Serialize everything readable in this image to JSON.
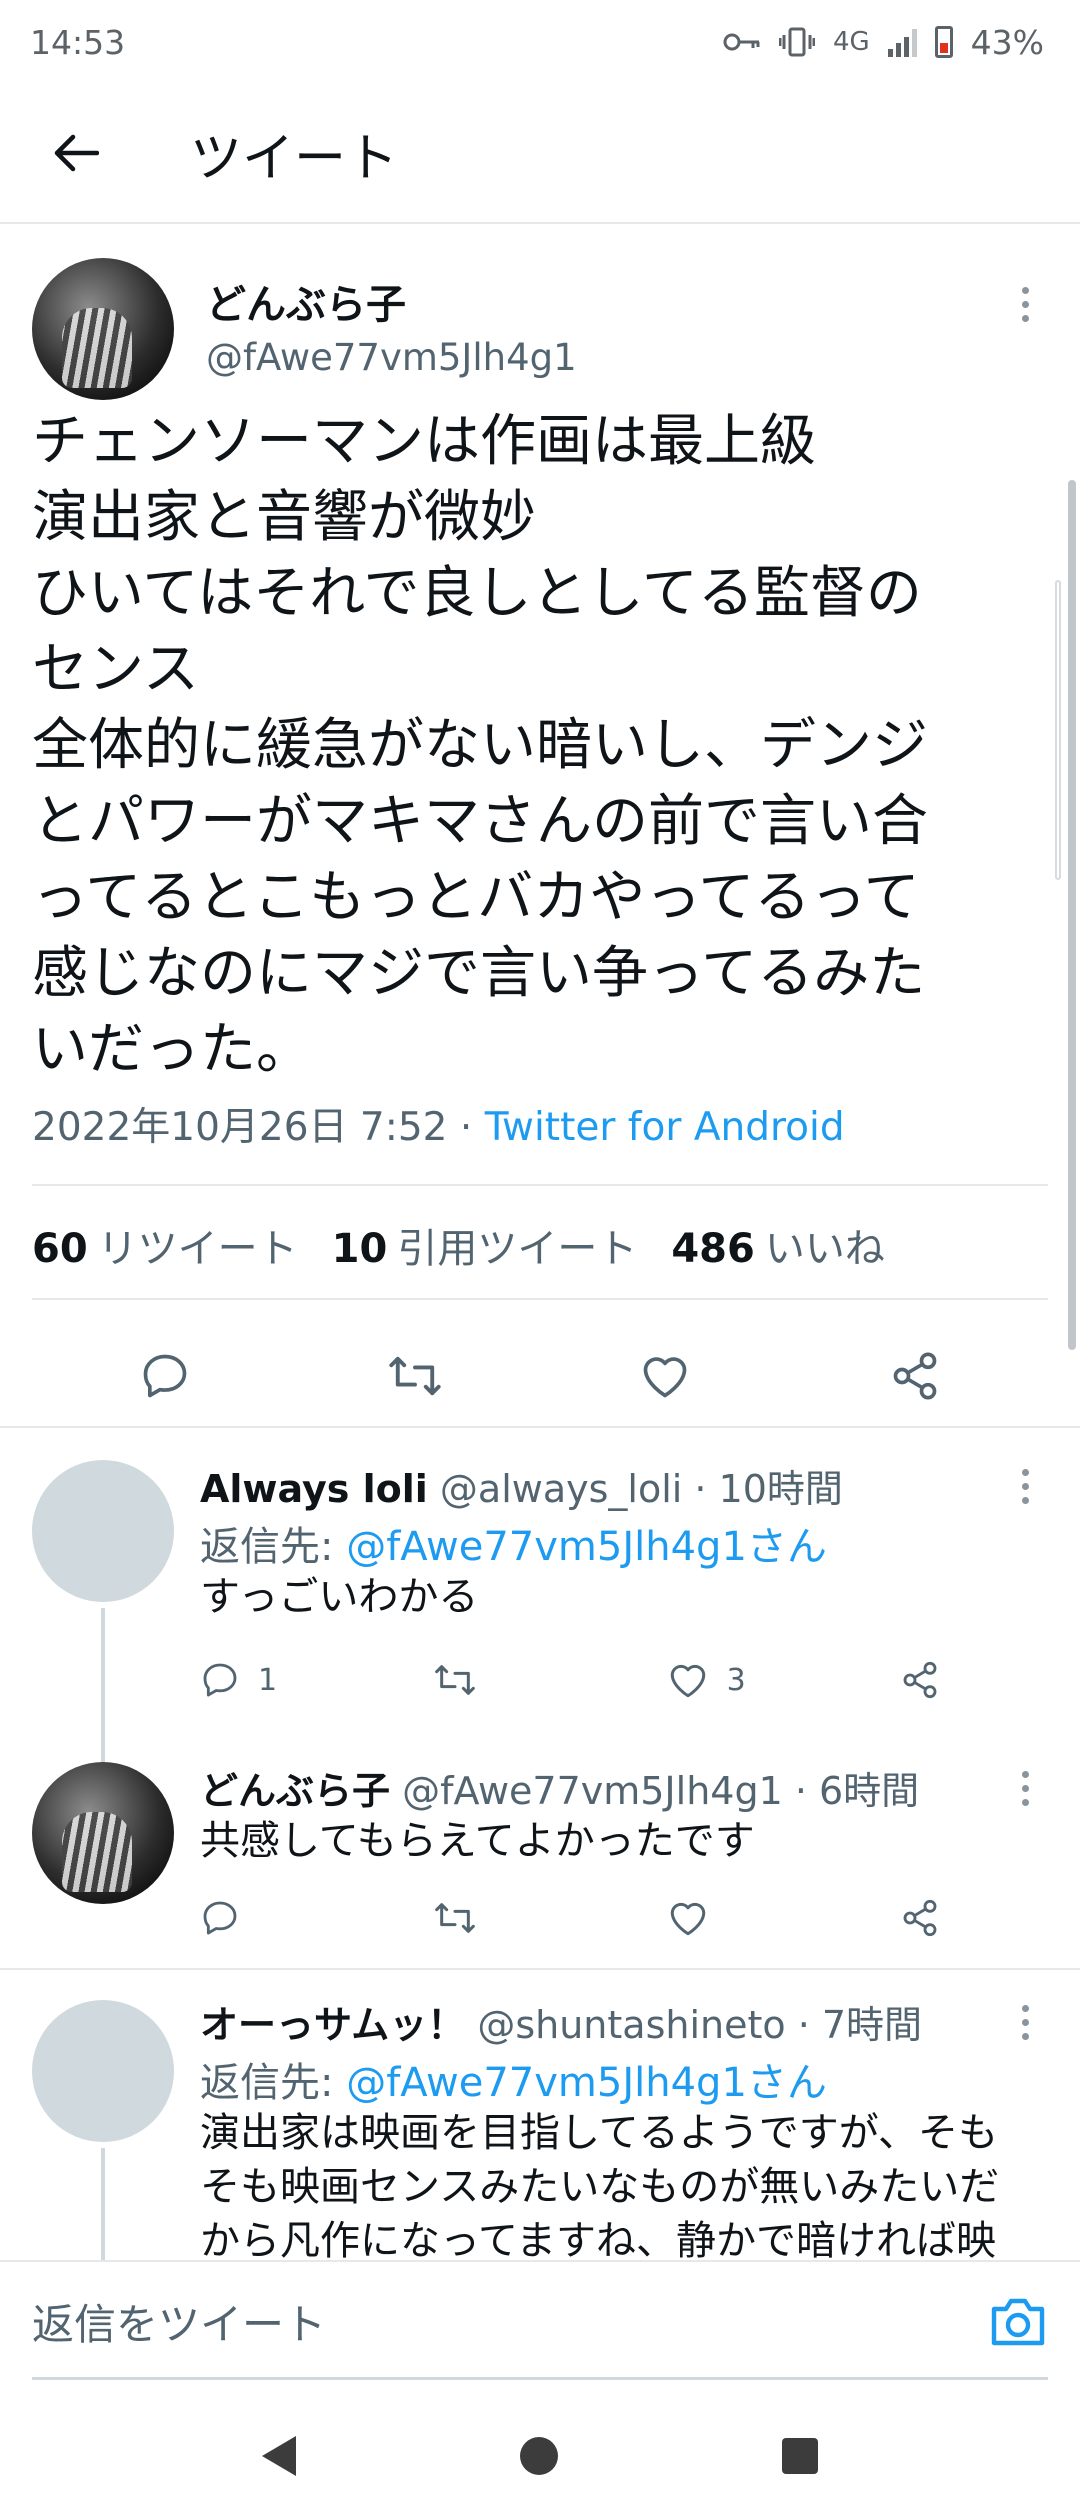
{
  "status_bar": {
    "time": "14:53",
    "network": "4G",
    "battery": "43%"
  },
  "header": {
    "title": "ツイート"
  },
  "main_tweet": {
    "name": "どんぶら子",
    "handle": "@fAwe77vm5Jlh4g1",
    "text_lines": [
      "チェンソーマンは作画は最上級",
      "演出家と音響が微妙",
      "ひいてはそれで良しとしてる監督の",
      "センス",
      "全体的に緩急がない暗いし、デンジ",
      "とパワーがマキマさんの前で言い合",
      "ってるとこもっとバカやってるって",
      "感じなのにマジで言い争ってるみた",
      "いだった。"
    ],
    "timestamp": "2022年10月26日 7:52",
    "dot": " · ",
    "source": "Twitter for Android",
    "retweets_count": "60",
    "retweets_label": "リツイート",
    "quotes_count": "10",
    "quotes_label": "引用ツイート",
    "likes_count": "486",
    "likes_label": "いいね"
  },
  "replies": [
    {
      "name": "Always loli",
      "handle": "@always_loli",
      "time": " · 10時間",
      "reply_to_label": "返信先: ",
      "reply_to_link": "@fAwe77vm5Jlh4g1さん",
      "text_lines": [
        "すっごいわかる"
      ],
      "reply_count": "1",
      "like_count": "3"
    },
    {
      "name": "どんぶら子",
      "handle": "@fAwe77vm5Jlh4g1",
      "time": " · 6時間",
      "text_lines": [
        "共感してもらえてよかったです"
      ]
    },
    {
      "name": "オーっサムッ！",
      "handle": "@shuntashineto",
      "time": " · 7時間",
      "reply_to_label": "返信先: ",
      "reply_to_link": "@fAwe77vm5Jlh4g1さん",
      "text_lines": [
        "演出家は映画を目指してるようですが、そも",
        "そも映画センスみたいなものが無いみたいだ",
        "から凡作になってますね、静かで暗ければ映"
      ]
    }
  ],
  "compose": {
    "placeholder": "返信をツイート"
  },
  "colors": {
    "accent": "#1d9bf0",
    "secondary_text": "#536471",
    "primary_text": "#0f1419"
  },
  "icons": [
    "back-arrow-icon",
    "kebab-menu-icon",
    "reply-icon",
    "retweet-icon",
    "like-icon",
    "share-icon",
    "camera-icon",
    "nav-back-icon",
    "nav-home-icon",
    "nav-recent-icon"
  ]
}
